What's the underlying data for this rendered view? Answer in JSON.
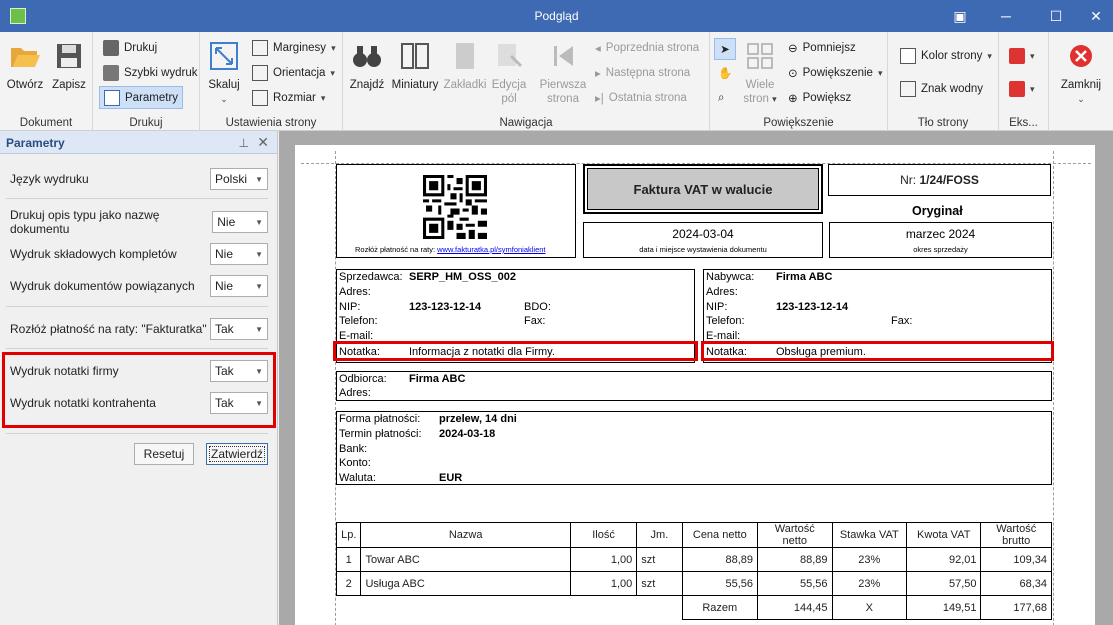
{
  "window": {
    "title": "Podgląd"
  },
  "ribbon": {
    "dokument": {
      "label": "Dokument",
      "open": "Otwórz",
      "save": "Zapisz"
    },
    "drukuj": {
      "label": "Drukuj",
      "print": "Drukuj",
      "quick": "Szybki wydruk",
      "params": "Parametry"
    },
    "ustawienia": {
      "label": "Ustawienia strony",
      "scale": "Skaluj",
      "margins": "Marginesy",
      "orientation": "Orientacja",
      "size": "Rozmiar"
    },
    "nawigacja": {
      "label": "Nawigacja",
      "find": "Znajdź",
      "thumbs": "Miniatury",
      "bookmarks": "Zakładki",
      "edit1": "Edycja",
      "edit2": "pól",
      "first1": "Pierwsza",
      "first2": "strona",
      "prev": "Poprzednia strona",
      "next": "Następna strona",
      "last": "Ostatnia strona"
    },
    "powiekszenie": {
      "label": "Powiększenie",
      "many1": "Wiele",
      "many2": "stron",
      "zoomout": "Pomniejsz",
      "zoom": "Powiększenie",
      "zoomin": "Powiększ"
    },
    "tlo": {
      "label": "Tło strony",
      "color": "Kolor strony",
      "watermark": "Znak wodny"
    },
    "eks": {
      "label": "Eks..."
    },
    "close": {
      "label": "Zamknij"
    }
  },
  "panel": {
    "title": "Parametry",
    "rows": [
      {
        "label": "Język wydruku",
        "value": "Polski"
      },
      {
        "label": "Drukuj opis typu jako nazwę dokumentu",
        "value": "Nie"
      },
      {
        "label": "Wydruk składowych kompletów",
        "value": "Nie"
      },
      {
        "label": "Wydruk dokumentów powiązanych",
        "value": "Nie"
      },
      {
        "label": "Rozłóż płatność na raty: \"Fakturatka\"",
        "value": "Tak"
      },
      {
        "label": "Wydruk notatki firmy",
        "value": "Tak"
      },
      {
        "label": "Wydruk notatki kontrahenta",
        "value": "Tak"
      }
    ],
    "reset": "Resetuj",
    "confirm": "Zatwierdź"
  },
  "invoice": {
    "qr_caption": "Rozłóż płatność na raty:",
    "qr_link": "www.fakturatka.pl/symfoniaklient",
    "title": "Faktura VAT w walucie",
    "nr_label": "Nr:",
    "nr": "1/24/FOSS",
    "original": "Oryginał",
    "date": "2024-03-04",
    "date_caption": "data i miejsce wystawienia dokumentu",
    "period": "marzec 2024",
    "period_caption": "okres sprzedaży",
    "seller": {
      "label": "Sprzedawca:",
      "name": "SERP_HM_OSS_002",
      "adres": "Adres:",
      "nip_label": "NIP:",
      "nip": "123-123-12-14",
      "bdo": "BDO:",
      "tel": "Telefon:",
      "fax": "Fax:",
      "email": "E-mail:",
      "note_label": "Notatka:",
      "note": "Informacja z notatki dla Firmy."
    },
    "buyer": {
      "label": "Nabywca:",
      "name": "Firma ABC",
      "adres": "Adres:",
      "nip_label": "NIP:",
      "nip": "123-123-12-14",
      "tel": "Telefon:",
      "fax": "Fax:",
      "email": "E-mail:",
      "note_label": "Notatka:",
      "note": "Obsługa premium."
    },
    "receiver": {
      "label": "Odbiorca:",
      "name": "Firma ABC",
      "adres": "Adres:"
    },
    "payment": {
      "form_label": "Forma płatności:",
      "form": "przelew, 14 dni",
      "term_label": "Termin płatności:",
      "term": "2024-03-18",
      "bank": "Bank:",
      "konto": "Konto:",
      "currency_label": "Waluta:",
      "currency": "EUR"
    },
    "table": {
      "headers": [
        "Lp.",
        "Nazwa",
        "Ilość",
        "Jm.",
        "Cena netto",
        "Wartość netto",
        "Stawka VAT",
        "Kwota VAT",
        "Wartość brutto"
      ],
      "rows": [
        [
          "1",
          "Towar ABC",
          "1,00",
          "szt",
          "88,89",
          "88,89",
          "23%",
          "92,01",
          "109,34"
        ],
        [
          "2",
          "Usługa ABC",
          "1,00",
          "szt",
          "55,56",
          "55,56",
          "23%",
          "57,50",
          "68,34"
        ]
      ],
      "sum": {
        "label": "Razem",
        "net": "144,45",
        "vat": "X",
        "tax": "149,51",
        "gross": "177,68"
      }
    }
  }
}
